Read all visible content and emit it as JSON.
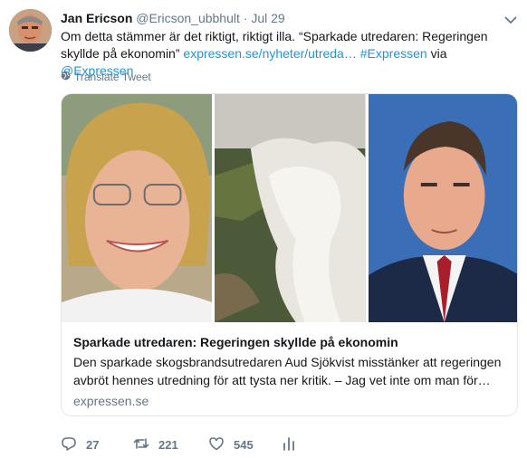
{
  "tweet": {
    "author_name": "Jan Ericson",
    "author_handle": "@Ericson_ubbhult",
    "separator": "·",
    "time": "Jul 29",
    "text_lead": "Om detta stämmer är det riktigt, riktigt illa. “Sparkade utredaren: Regeringen skyllde på ekonomin”",
    "link_url": "expressen.se/nyheter/utreda…",
    "hashtag": "#Expressen",
    "via_word": "via",
    "mention": "@Expressen",
    "translate_label": "Translate Tweet"
  },
  "card": {
    "title": "Sparkade utredaren: Regeringen skyllde på ekonomin",
    "description": "Den sparkade skogsbrandsutredaren Aud Sjökvist misstänker att regeringen avbröt hennes utredning för att tysta ner kritik. – Jag vet inte om man för…",
    "domain": "expressen.se"
  },
  "actions": {
    "replies": "27",
    "retweets": "221",
    "likes": "545"
  },
  "colors": {
    "link": "#1b95e0",
    "secondary_text": "#657786",
    "border": "#e1e8ed"
  }
}
